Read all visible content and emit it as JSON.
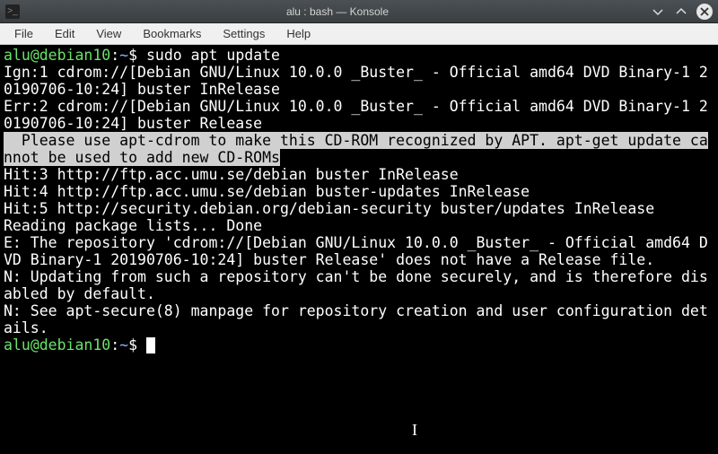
{
  "window": {
    "title": "alu : bash — Konsole"
  },
  "menubar": {
    "items": [
      "File",
      "Edit",
      "View",
      "Bookmarks",
      "Settings",
      "Help"
    ]
  },
  "prompt": {
    "user": "alu",
    "at": "@",
    "host": "debian10",
    "colon": ":",
    "path": "~",
    "symbol": "$"
  },
  "command": "sudo apt update",
  "output": {
    "l1": "Ign:1 cdrom://[Debian GNU/Linux 10.0.0 _Buster_ - Official amd64 DVD Binary-1 20190706-10:24] buster InRelease",
    "l2": "Err:2 cdrom://[Debian GNU/Linux 10.0.0 _Buster_ - Official amd64 DVD Binary-1 20190706-10:24] buster Release",
    "hl": "  Please use apt-cdrom to make this CD-ROM recognized by APT. apt-get update cannot be used to add new CD-ROMs",
    "l3": "Hit:3 http://ftp.acc.umu.se/debian buster InRelease",
    "l4": "Hit:4 http://ftp.acc.umu.se/debian buster-updates InRelease",
    "l5": "Hit:5 http://security.debian.org/debian-security buster/updates InRelease",
    "l6": "Reading package lists... Done",
    "l7": "E: The repository 'cdrom://[Debian GNU/Linux 10.0.0 _Buster_ - Official amd64 DVD Binary-1 20190706-10:24] buster Release' does not have a Release file.",
    "l8": "N: Updating from such a repository can't be done securely, and is therefore disabled by default.",
    "l9": "N: See apt-secure(8) manpage for repository creation and user configuration details."
  }
}
